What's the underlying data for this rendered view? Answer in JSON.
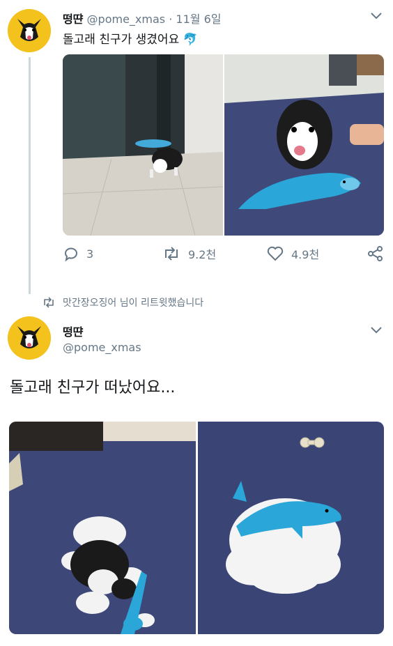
{
  "tweet1": {
    "name": "떵땬",
    "handle": "@pome_xmas",
    "separator": "·",
    "date": "11월 6일",
    "text": "돌고래 친구가 생겼어요",
    "emoji": "🐬",
    "actions": {
      "reply_count": "3",
      "retweet_count": "9.2천",
      "like_count": "4.9천"
    }
  },
  "retweet_notice": "맛간장오징어 님이 리트윗했습니다",
  "tweet2": {
    "name": "떵땬",
    "handle": "@pome_xmas",
    "text": "돌고래 친구가 떠났어요..."
  },
  "colors": {
    "avatar_bg": "#f3c21d",
    "text": "#14171a",
    "muted": "#657786",
    "carpet": "#3b4674",
    "whale": "#2aa7d8"
  }
}
